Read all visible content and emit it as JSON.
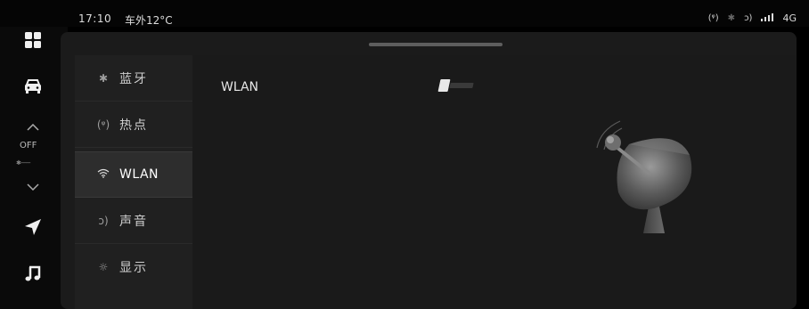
{
  "status_bar": {
    "time": "17:10",
    "temperature": "车外12°C",
    "hotspot_icon": "(ᵠ)",
    "bluetooth_icon": "✱",
    "volume_icon": "ↄ)",
    "network": "4G"
  },
  "climate": {
    "state": "OFF",
    "fan_level": "✱-------"
  },
  "menu": {
    "items": [
      {
        "icon": "✱",
        "label": "蓝牙"
      },
      {
        "icon": "(ᵠ)",
        "label": "热点"
      },
      {
        "icon": "≋",
        "label": "WLAN"
      },
      {
        "icon": "ↄ)",
        "label": "声音"
      },
      {
        "icon": "☼",
        "label": "显示"
      }
    ]
  },
  "content": {
    "wlan_label": "WLAN",
    "wlan_enabled": true
  },
  "colors": {
    "background": "#000000",
    "panel": "#1b1b1b",
    "active_item": "#2d2d2d",
    "text": "#e6e6e6"
  }
}
